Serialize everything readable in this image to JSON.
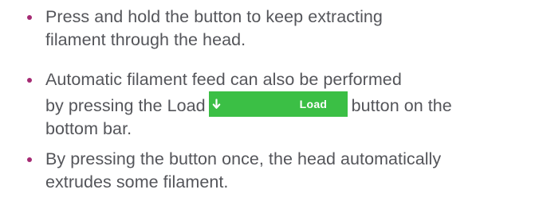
{
  "colors": {
    "text": "#54555a",
    "bullet": "#a52a73",
    "load_button": "#3bbf45",
    "load_button_text": "#ffffff"
  },
  "bullets": [
    {
      "lines": [
        "Press and hold the button to keep extracting",
        "filament through the head."
      ]
    },
    {
      "line1": "Automatic filament feed can also be performed",
      "line2_before": "by pressing the Load",
      "line2_after": "button on the",
      "line3": "bottom bar.",
      "button": {
        "icon": "arrow-down-icon",
        "label": "Load"
      }
    },
    {
      "lines": [
        "By pressing the button once, the head automatically",
        "extrudes some filament."
      ]
    }
  ]
}
